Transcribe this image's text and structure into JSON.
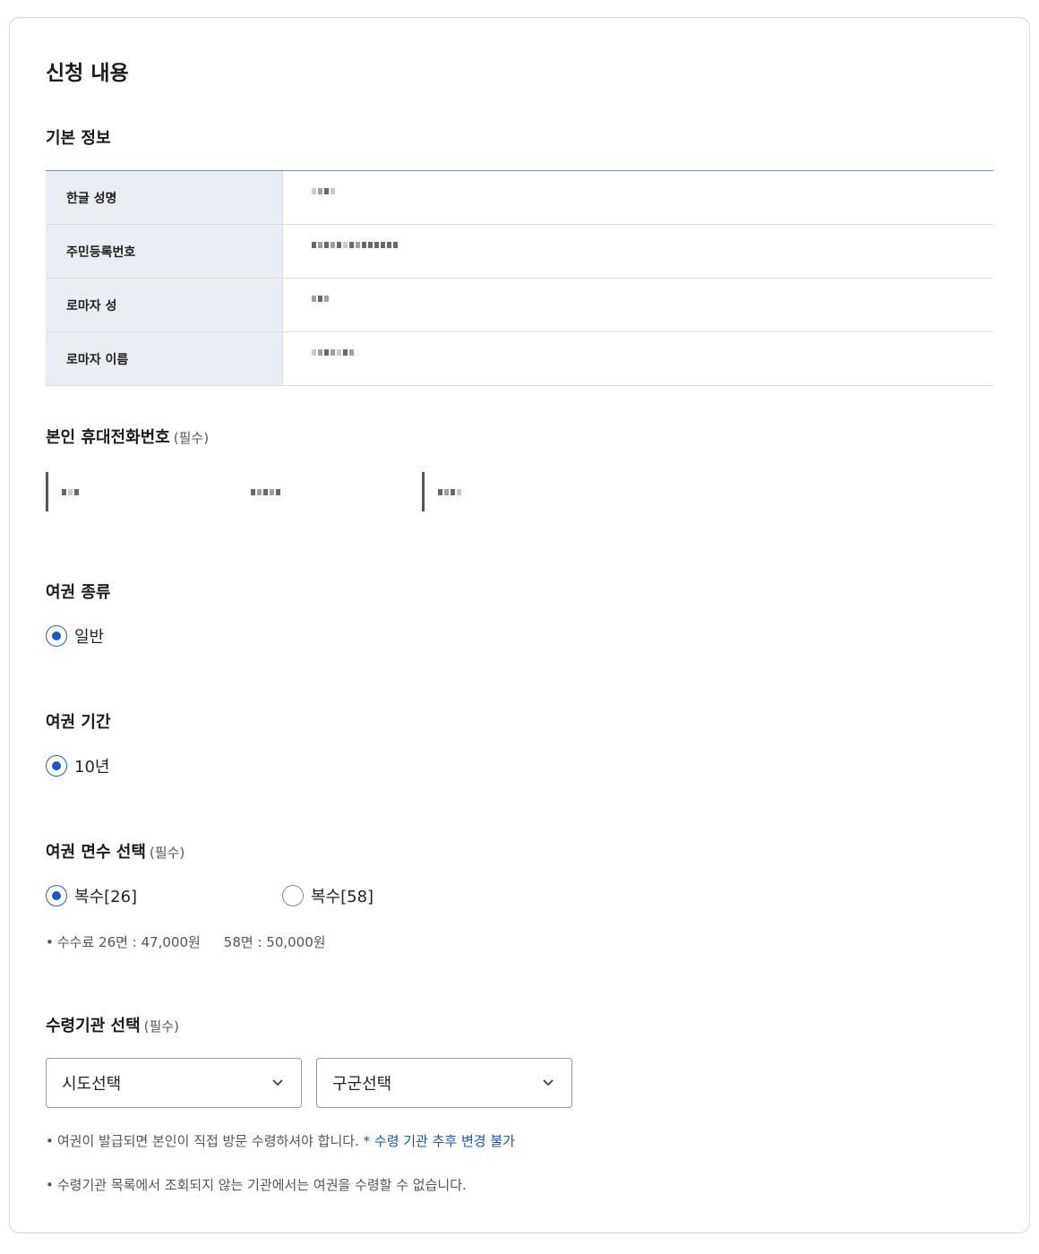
{
  "page_title": "신청 내용",
  "basic_info": {
    "title": "기본 정보",
    "rows": [
      {
        "label": "한글 성명"
      },
      {
        "label": "주민등록번호"
      },
      {
        "label": "로마자 성"
      },
      {
        "label": "로마자 이름"
      }
    ]
  },
  "phone": {
    "title": "본인 휴대전화번호",
    "required": "(필수)"
  },
  "passport_type": {
    "title": "여권 종류",
    "options": [
      {
        "label": "일반",
        "selected": true
      }
    ]
  },
  "passport_period": {
    "title": "여권 기간",
    "options": [
      {
        "label": "10년",
        "selected": true
      }
    ]
  },
  "page_count": {
    "title": "여권 면수 선택",
    "required": "(필수)",
    "options": [
      {
        "label": "복수[26]",
        "selected": true
      },
      {
        "label": "복수[58]",
        "selected": false
      }
    ],
    "fee_bullet": "•",
    "fee_a": "수수료 26면 : 47,000원",
    "fee_b": "58면 : 50,000원"
  },
  "pickup": {
    "title": "수령기관 선택",
    "required": "(필수)",
    "select_sido": "시도선택",
    "select_gugun": "구군선택",
    "note1_bullet": "•",
    "note1_text": "여권이 발급되면 본인이 직접 방문 수령하셔야 합니다.",
    "note1_link": "* 수령 기관 추후 변경 불가",
    "note2_bullet": "•",
    "note2_text": "수령기관 목록에서 조회되지 않는 기관에서는 여권을 수령할 수 없습니다."
  },
  "icons": {
    "select_arrow": "chevron-down-icon",
    "radio": "radio-icon"
  },
  "colors": {
    "accent": "#1a57c6",
    "link": "#1a57a8",
    "table_header_bg": "#e9eef4",
    "table_top_border": "#7d96ad"
  }
}
